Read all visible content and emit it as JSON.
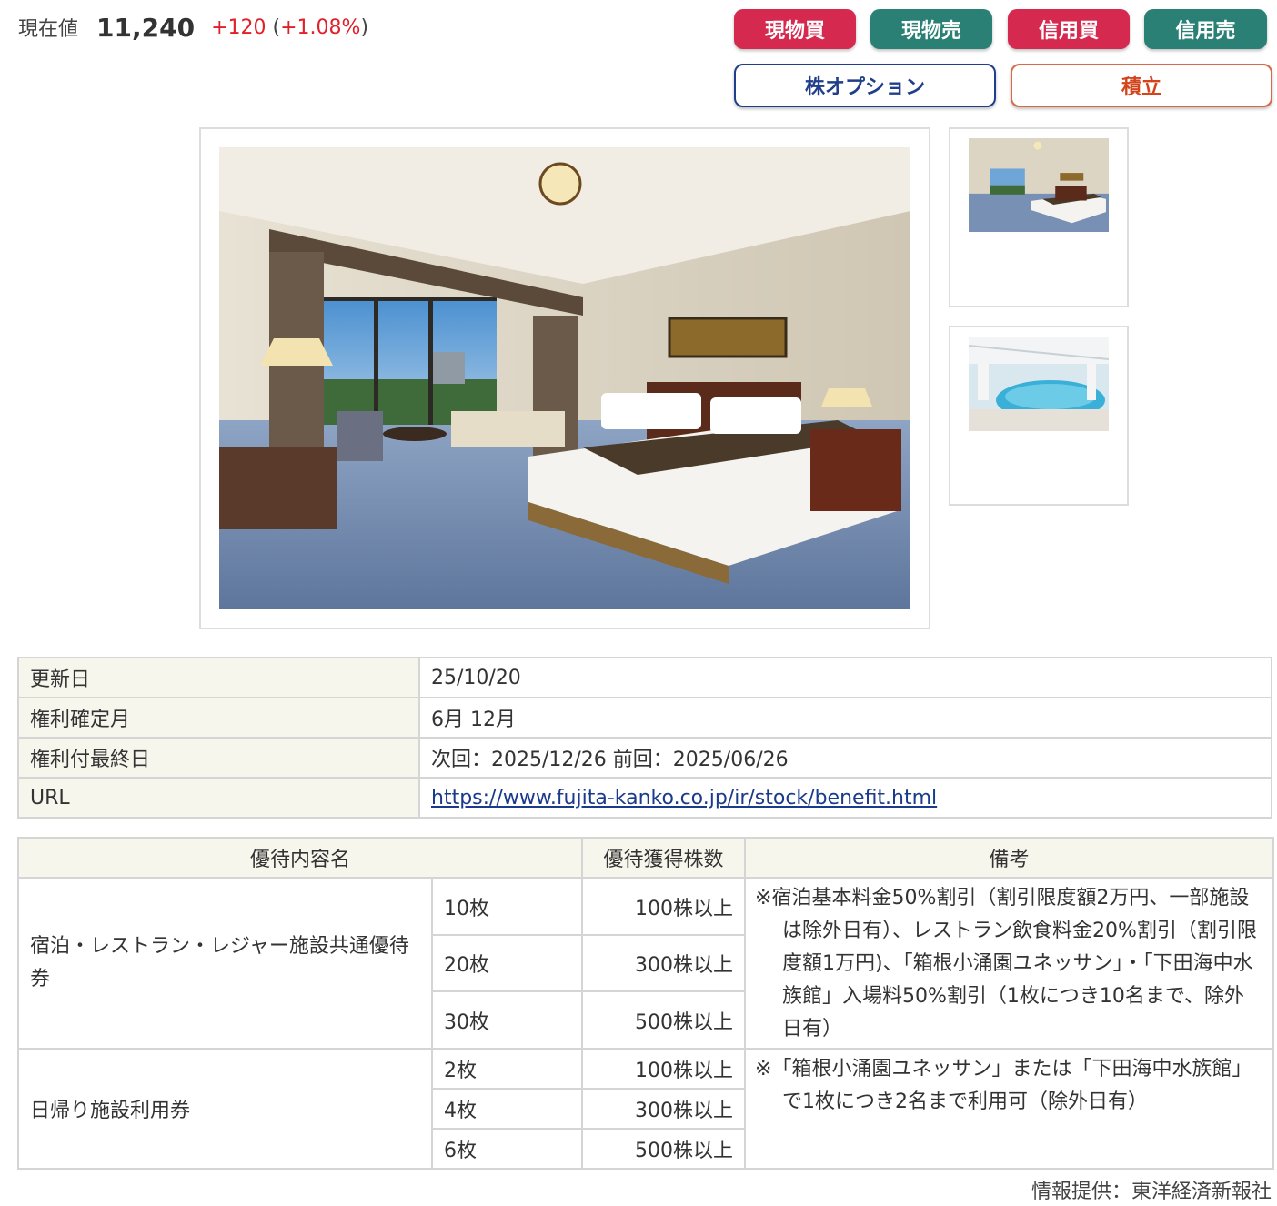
{
  "price": {
    "label": "現在値",
    "value": "11,240",
    "change": "+120",
    "change_pct": "+1.08%",
    "change_color": "#e0202a"
  },
  "buttons": {
    "genbutsu_buy": "現物買",
    "genbutsu_sell": "現物売",
    "shinyo_buy": "信用買",
    "shinyo_sell": "信用売",
    "stock_option": "株オプション",
    "tsumitate": "積立"
  },
  "colors": {
    "buy": "#d6294f",
    "sell": "#2b8075",
    "table_header_bg": "#f7f6ec",
    "link": "#1a3a8c"
  },
  "gallery": {
    "main_image": "hotel-guest-room-photo",
    "thumbnails": [
      "hotel-guest-room-photo",
      "indoor-pool-photo"
    ]
  },
  "info": {
    "rows": [
      {
        "label": "更新日",
        "value": "25/10/20"
      },
      {
        "label": "権利確定月",
        "value": "6月 12月"
      },
      {
        "label": "権利付最終日",
        "value": "次回：2025/12/26 前回：2025/06/26"
      },
      {
        "label": "URL",
        "value": "https://www.fujita-kanko.co.jp/ir/stock/benefit.html"
      }
    ]
  },
  "benefits": {
    "headers": [
      "優待内容名",
      "優待獲得株数",
      "備考"
    ],
    "groups": [
      {
        "name": "宿泊・レストラン・レジャー施設共通優待券",
        "tiers": [
          {
            "qty": "10枚",
            "shares": "100株以上"
          },
          {
            "qty": "20枚",
            "shares": "300株以上"
          },
          {
            "qty": "30枚",
            "shares": "500株以上"
          }
        ],
        "note": "※宿泊基本料金50%割引（割引限度額2万円、一部施設は除外日有）、レストラン飲食料金20%割引（割引限度額1万円)、「箱根小涌園ユネッサン」・「下田海中水族館」入場料50%割引（1枚につき10名まで、除外日有）"
      },
      {
        "name": "日帰り施設利用券",
        "tiers": [
          {
            "qty": "2枚",
            "shares": "100株以上"
          },
          {
            "qty": "4枚",
            "shares": "300株以上"
          },
          {
            "qty": "6枚",
            "shares": "500株以上"
          }
        ],
        "note": "※「箱根小涌園ユネッサン」または「下田海中水族館」で1枚につき2名まで利用可（除外日有）"
      }
    ]
  },
  "source": "情報提供：東洋経済新報社"
}
